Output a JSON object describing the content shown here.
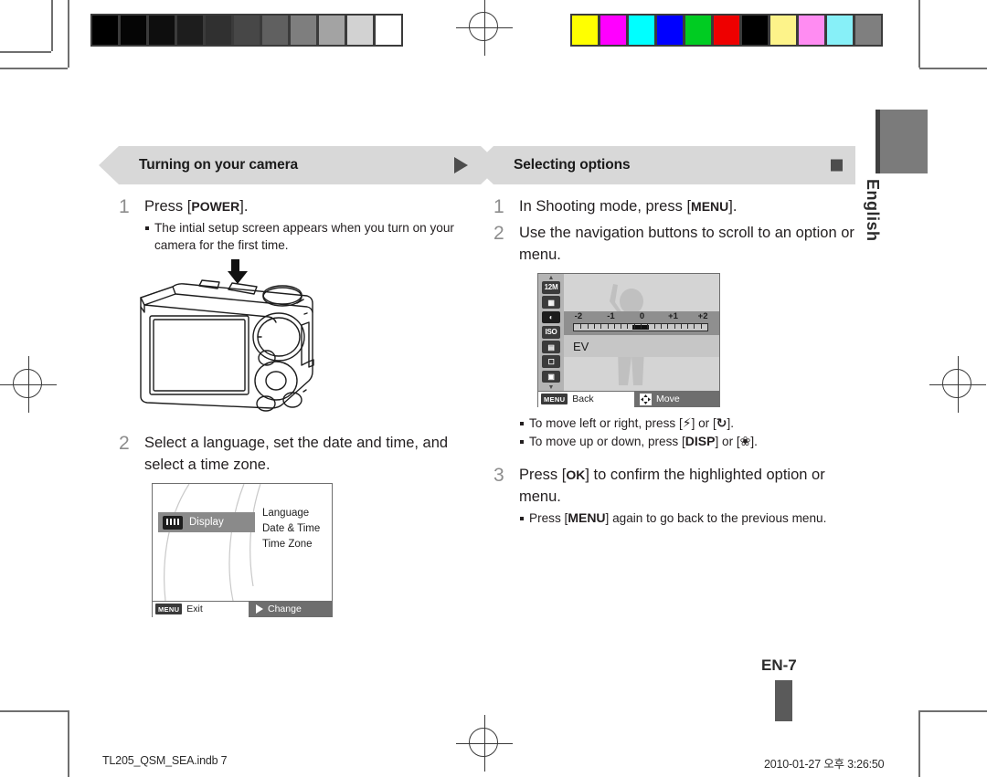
{
  "document": {
    "page_number_label": "EN-7",
    "language_tab": "English"
  },
  "footer": {
    "file_name": "TL205_QSM_SEA.indb   7",
    "timestamp": "2010-01-27   오후 3:26:50"
  },
  "calibration": {
    "grayscale": [
      "#000000",
      "#050505",
      "#0e0e0e",
      "#1d1d1d",
      "#303030",
      "#474747",
      "#606060",
      "#7e7e7e",
      "#a3a3a3",
      "#d2d2d2",
      "#ffffff"
    ],
    "colors": [
      "#ffff00",
      "#ff00ff",
      "#00ffff",
      "#0000ff",
      "#00cc22",
      "#ee0000",
      "#000000",
      "#fff municipal",
      "#ff88ff",
      "#88f2ff",
      "#808080"
    ],
    "colors_fixed": [
      "#ffff00",
      "#ff00ff",
      "#00ffff",
      "#0000ff",
      "#00cc22",
      "#ee0000",
      "#000000",
      "#fdf38a",
      "#ff8cf2",
      "#87f0f8",
      "#7f7f7f"
    ]
  },
  "left_column": {
    "header": {
      "title": "Turning on your camera",
      "marker": "triangle-right"
    },
    "steps": [
      {
        "number": "1",
        "text_parts": [
          "Press [",
          "POWER",
          "]."
        ],
        "bullets": [
          "The intial setup screen appears when you turn on your camera for the first time."
        ]
      },
      {
        "number": "2",
        "text": "Select a language, set the date and time, and select a time zone.",
        "bullets": []
      }
    ],
    "camera_illustration": {
      "name": "camera-rear-view",
      "annotation": "down-arrow-to-power-button"
    },
    "lcd_language": {
      "selected_item": "Display",
      "options": [
        "Language",
        "Date & Time",
        "Time Zone"
      ],
      "bottom_bar": {
        "left_key": "MENU",
        "left_label": "Exit",
        "right_icon": "triangle-right-icon",
        "right_label": "Change"
      }
    }
  },
  "right_column": {
    "header": {
      "title": "Selecting options",
      "marker": "square"
    },
    "steps": [
      {
        "number": "1",
        "text_parts": [
          "In Shooting mode, press [",
          "MENU",
          "]."
        ]
      },
      {
        "number": "2",
        "text": "Use the navigation buttons to scroll to an option or menu.",
        "bullets": [
          {
            "parts": [
              "To move left or right, press [",
              "flash-icon",
              "] or [",
              "timer-icon",
              "]."
            ]
          },
          {
            "parts": [
              "To move up or down, press [",
              "DISP",
              "] or [",
              "macro-icon",
              "]."
            ]
          }
        ]
      },
      {
        "number": "3",
        "text_parts": [
          "Press [",
          "OK",
          "] to confirm the highlighted option or menu."
        ],
        "bullets": [
          {
            "parts": [
              "Press [",
              "MENU",
              "] again to go back to the previous menu."
            ]
          }
        ]
      }
    ],
    "lcd_menu": {
      "icons": [
        "12M",
        "quality-icon",
        "ev-icon",
        "ISO",
        "white-balance-icon",
        "face-detect-off-icon",
        "focus-area-icon"
      ],
      "selected_icon": "ev-icon",
      "ev_scale": {
        "labels": [
          "-2",
          "-1",
          "0",
          "+1",
          "+2"
        ],
        "current_value": "0"
      },
      "option_name": "EV",
      "bottom_bar": {
        "left_key": "MENU",
        "left_label": "Back",
        "right_icon": "navigation-pad-icon",
        "right_label": "Move"
      }
    }
  },
  "bullet_texts": {
    "move_lr_1": "To move left or right, press [",
    "move_lr_2": "] or [",
    "move_lr_3": "].",
    "move_ud_1": "To move up or down, press [",
    "ok_1": "Press [",
    "ok_2": "] to confirm the highlighted option or menu.",
    "menu_again_1": "Press [",
    "menu_again_2": "] again to go back to the previous menu.",
    "press_1": "Press [",
    "press_3": "].",
    "shoot_1": "In Shooting mode, press ["
  },
  "keys": {
    "power": "POWER",
    "menu": "MENU",
    "ok": "OK",
    "disp": "DISP",
    "flash_glyph": "⚡",
    "timer_glyph": "↻",
    "macro_glyph": "❀"
  }
}
